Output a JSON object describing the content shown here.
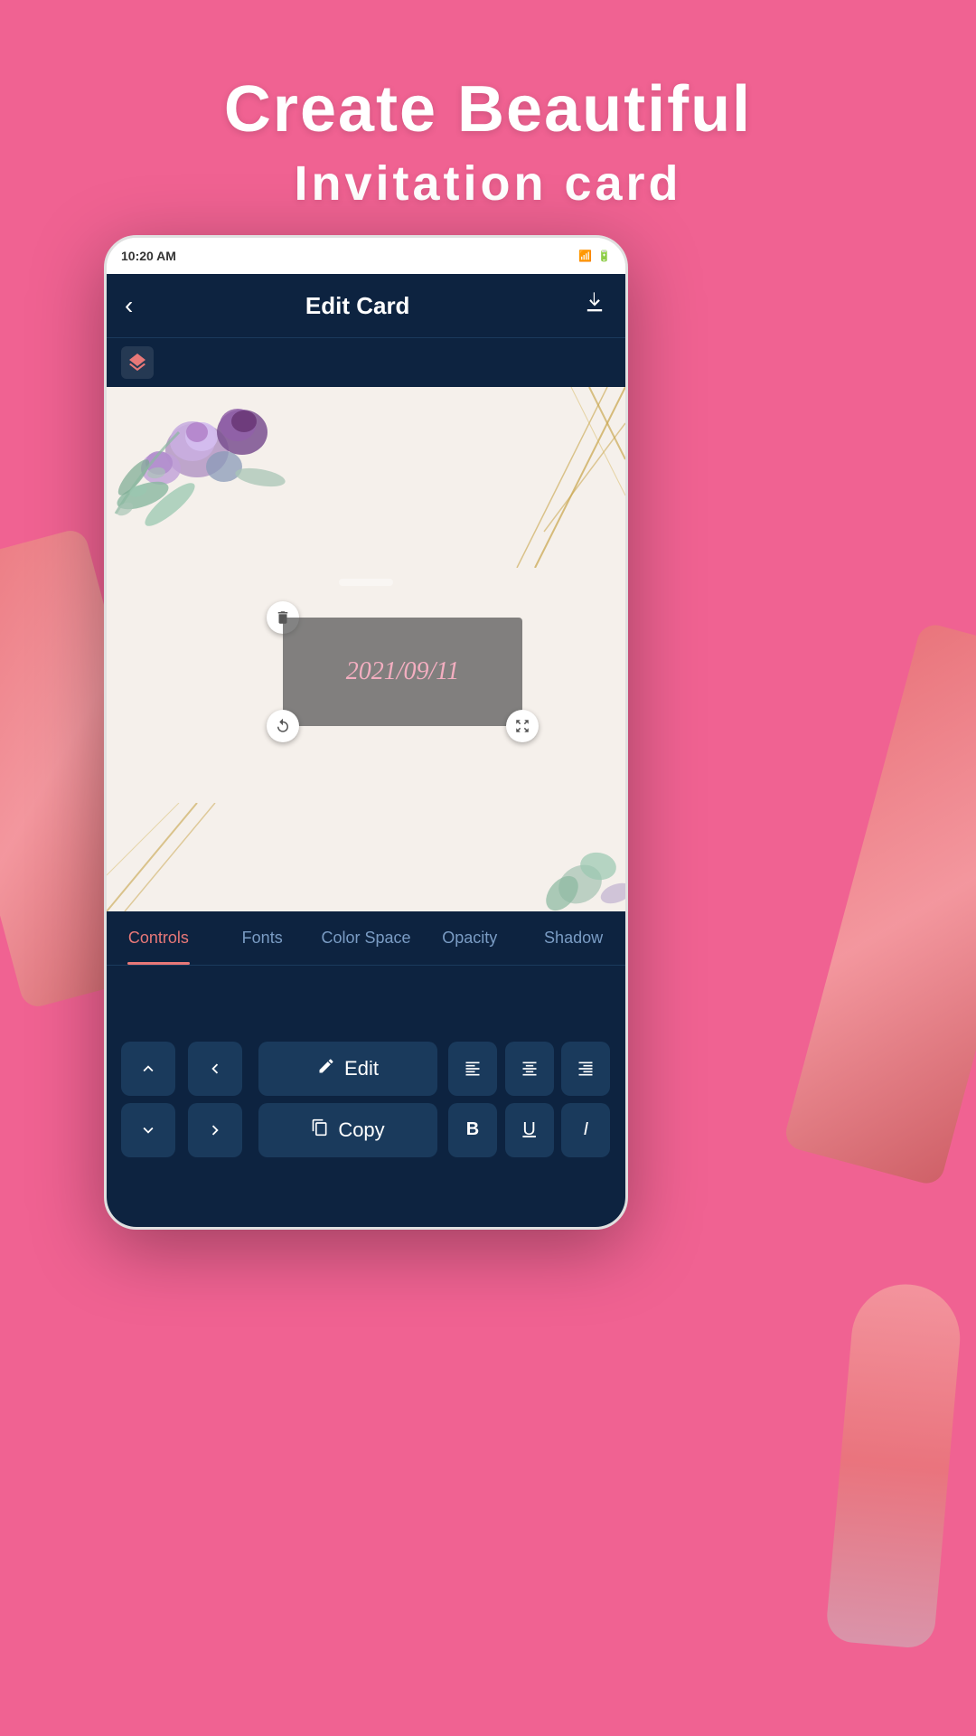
{
  "hero": {
    "title": "Create Beautiful",
    "subtitle": "Invitation card"
  },
  "status_bar": {
    "time": "10:20 AM",
    "battery": "100",
    "signal": "●●●"
  },
  "header": {
    "title": "Edit Card",
    "back_icon": "‹",
    "download_icon": "⬇"
  },
  "tabs": {
    "items": [
      {
        "label": "Controls",
        "active": true
      },
      {
        "label": "Fonts",
        "active": false
      },
      {
        "label": "Color Space",
        "active": false
      },
      {
        "label": "Opacity",
        "active": false
      },
      {
        "label": "Shadow",
        "active": false
      }
    ]
  },
  "text_element": {
    "content": "2021/09/11"
  },
  "controls": {
    "arrow_up": "∧",
    "arrow_down": "∨",
    "arrow_left": "‹",
    "arrow_right": "›",
    "edit_label": "Edit",
    "copy_label": "Copy",
    "align_left": "≡",
    "align_center": "≡",
    "align_right": "≡",
    "bold": "B",
    "underline": "U",
    "italic": "I"
  }
}
